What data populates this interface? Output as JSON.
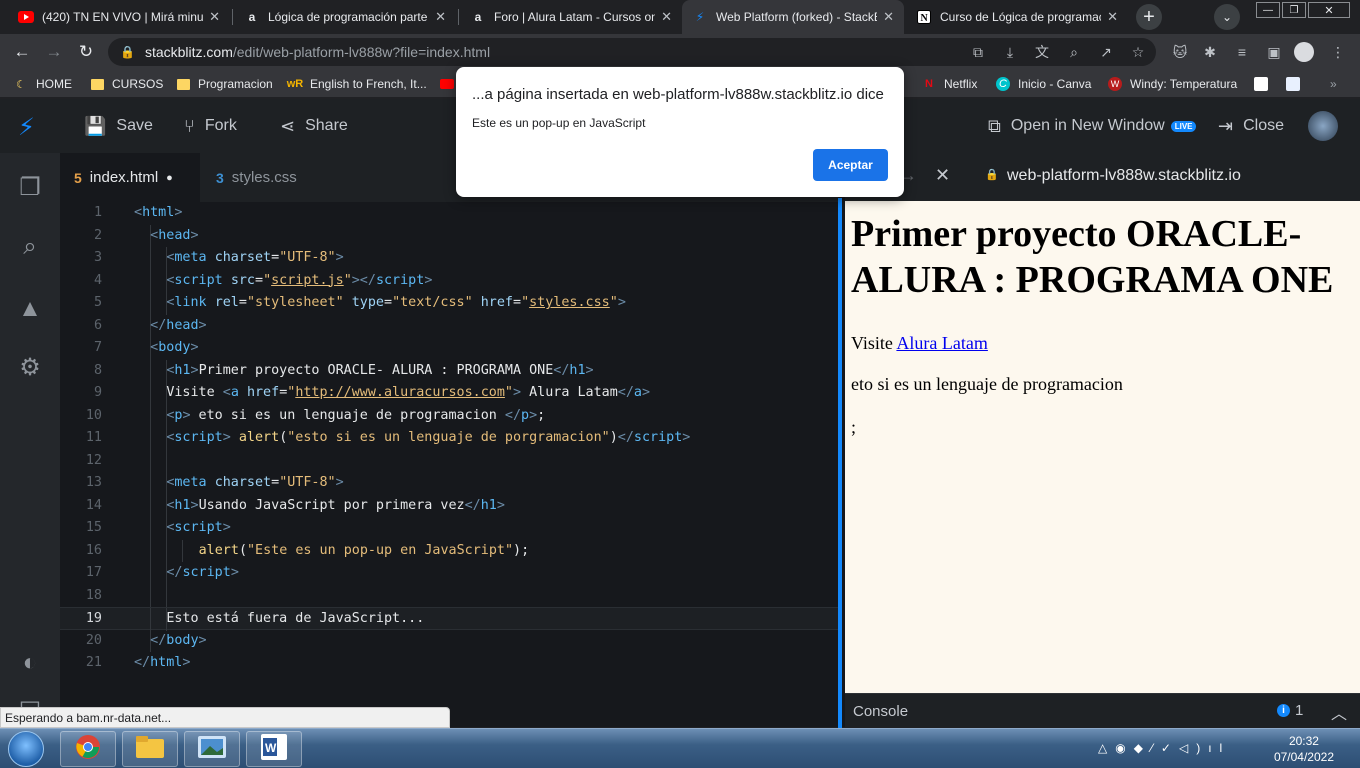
{
  "browser": {
    "tabs": [
      {
        "title": "(420) TN EN VIVO | Mirá minuto",
        "icon": "youtube-icon"
      },
      {
        "title": "Lógica de programación parte",
        "icon": "alura-icon"
      },
      {
        "title": "Foro | Alura Latam - Cursos on",
        "icon": "alura-icon"
      },
      {
        "title": "Web Platform (forked) - StackB",
        "icon": "stackblitz-icon"
      },
      {
        "title": "Curso de Lógica de programació",
        "icon": "notion-icon"
      }
    ],
    "url_host": "stackblitz.com",
    "url_path": "/edit/web-platform-lv888w?file=index.html",
    "bookmarks": [
      "HOME",
      "CURSOS",
      "Programacion",
      "English to French, It...",
      "Netflix",
      "Inicio - Canva",
      "Windy: Temperatura"
    ]
  },
  "dialog": {
    "title": "...a página insertada en web-platform-lv888w.stackblitz.io dice",
    "message": "Este es un pop-up en JavaScript",
    "button": "Aceptar"
  },
  "stackblitz": {
    "save": "Save",
    "fork": "Fork",
    "share": "Share",
    "open_new_window": "Open in New Window",
    "live_badge": "LIVE",
    "close": "Close"
  },
  "editor": {
    "tabs": [
      {
        "name": "index.html",
        "modified": "●"
      },
      {
        "name": "styles.css"
      }
    ],
    "current_line": 19,
    "line_numbers": [
      "1",
      "2",
      "3",
      "4",
      "5",
      "6",
      "7",
      "8",
      "9",
      "10",
      "11",
      "12",
      "13",
      "14",
      "15",
      "16",
      "17",
      "18",
      "19",
      "20",
      "21"
    ]
  },
  "preview": {
    "address": "web-platform-lv888w.stackblitz.io",
    "heading": "Primer proyecto ORACLE- ALURA : PROGRAMA ONE",
    "visit_text": "Visite ",
    "link_text": "Alura Latam",
    "paragraph": "eto si es un lenguaje de programacion",
    "stray_text": ";"
  },
  "console": {
    "label": "Console",
    "info_count": "1"
  },
  "status_text": "Esperando a bam.nr-data.net...",
  "taskbar": {
    "time": "20:32",
    "date": "07/04/2022"
  },
  "colors": {
    "accent": "#1389fd",
    "dialog_button": "#1a73e8",
    "preview_bg": "#fdf8ee"
  }
}
